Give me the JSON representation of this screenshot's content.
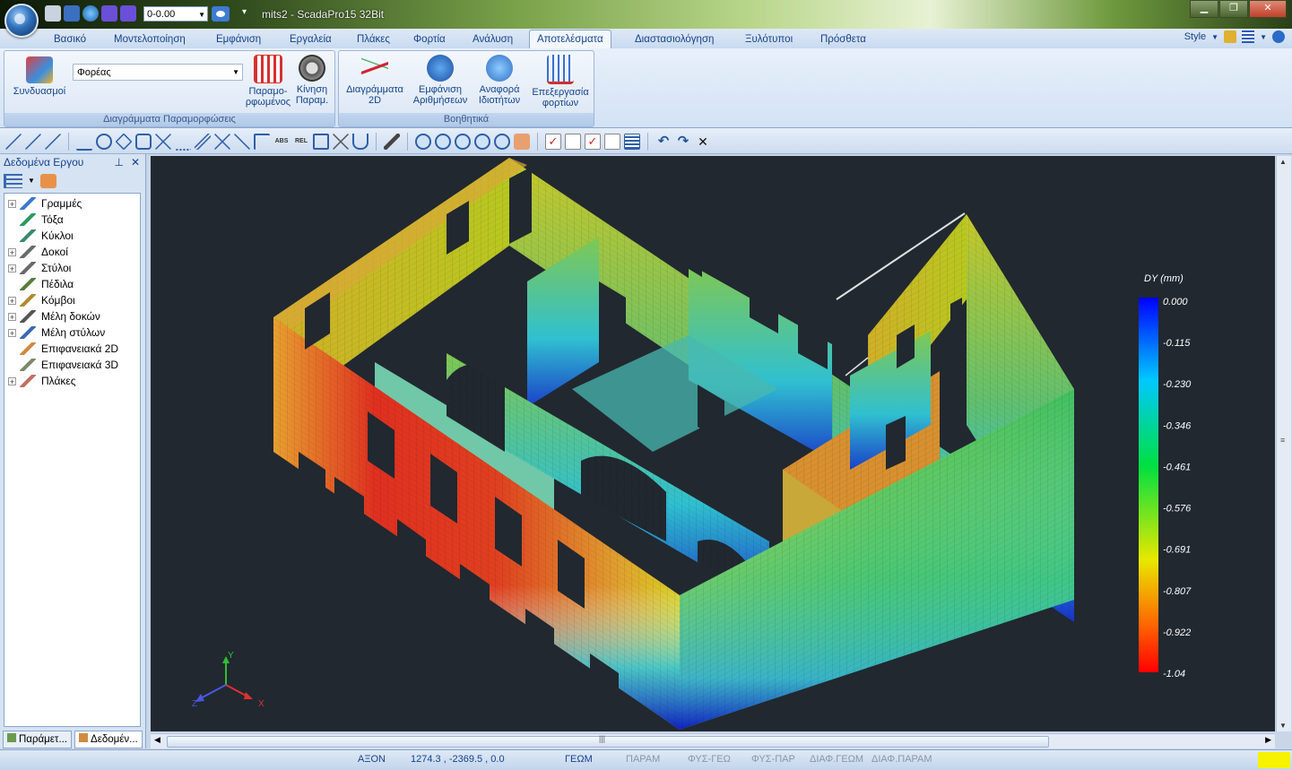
{
  "window": {
    "title": "mits2 - ScadaPro15 32Bit",
    "qat_combo_value": "0-0.00",
    "controls": [
      "▁",
      "❐",
      "✕"
    ]
  },
  "tabs": [
    {
      "label": "Βασικό"
    },
    {
      "label": "Μοντελοποίηση"
    },
    {
      "label": "Εμφάνιση"
    },
    {
      "label": "Εργαλεία"
    },
    {
      "label": "Πλάκες"
    },
    {
      "label": "Φορτία"
    },
    {
      "label": "Ανάλυση"
    },
    {
      "label": "Αποτελέσματα",
      "active": true
    },
    {
      "label": "Διαστασιολόγηση"
    },
    {
      "label": "Ξυλότυποι"
    },
    {
      "label": "Πρόσθετα"
    }
  ],
  "style_menu": {
    "label": "Style"
  },
  "ribbon": {
    "group1": {
      "label": "Διαγράμματα Παραμορφώσεις",
      "combo_value": "Φορέας",
      "btn_combinations": "Συνδυασμοί",
      "btn_deformed_1": "Παραμο-",
      "btn_deformed_2": "ρφωμένος",
      "btn_motion_1": "Κίνηση",
      "btn_motion_2": "Παραμ."
    },
    "group2": {
      "label": "Βοηθητικά",
      "btn_diagrams_1": "Διαγράμματα",
      "btn_diagrams_2": "2D",
      "btn_numbers_1": "Εμφάνιση",
      "btn_numbers_2": "Αριθμήσεων",
      "btn_props_1": "Αναφορά",
      "btn_props_2": "Ιδιοτήτων",
      "btn_loads_1": "Επεξεργασία",
      "btn_loads_2": "φορτίων"
    }
  },
  "panel": {
    "title": "Δεδομένα Εργου",
    "items": [
      {
        "label": "Γραμμές",
        "expandable": true
      },
      {
        "label": "Τόξα",
        "expandable": false
      },
      {
        "label": "Κύκλοι",
        "expandable": false
      },
      {
        "label": "Δοκοί",
        "expandable": true
      },
      {
        "label": "Στύλοι",
        "expandable": true
      },
      {
        "label": "Πέδιλα",
        "expandable": false
      },
      {
        "label": "Κόμβοι",
        "expandable": true
      },
      {
        "label": "Μέλη δοκών",
        "expandable": true
      },
      {
        "label": "Μέλη στύλων",
        "expandable": true
      },
      {
        "label": "Επιφανειακά 2D",
        "expandable": false
      },
      {
        "label": "Επιφανειακά 3D",
        "expandable": false
      },
      {
        "label": "Πλάκες",
        "expandable": true
      }
    ],
    "bottom_tabs": [
      "Παράμετ...",
      "Δεδομέν..."
    ]
  },
  "legend": {
    "title": "DY (mm)",
    "values": [
      "0.000",
      "-0.115",
      "-0.230",
      "-0.346",
      "-0.461",
      "-0.576",
      "-0.691",
      "-0.807",
      "-0.922",
      "-1.04"
    ]
  },
  "axes": {
    "x": "X",
    "y": "Y",
    "z": "Z"
  },
  "status": {
    "axon": "ΑΞΟΝ",
    "coords": "1274.3 , -2369.5 , 0.0",
    "geom": "ΓΕΩΜ",
    "param": "ΠΑΡΑΜ",
    "fys_geo": "ΦΥΣ-ΓΕΩ",
    "fys_par": "ΦΥΣ-ΠΑΡ",
    "diaf_geom": "ΔΙΑΦ.ΓΕΩΜ",
    "diaf_param": "ΔΙΑΦ.ΠΑΡΑΜ"
  }
}
